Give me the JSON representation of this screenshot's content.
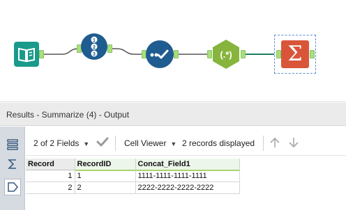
{
  "workflow": {
    "tools": [
      {
        "name": "input-data-tool",
        "icon": "book-icon",
        "color": "#1a9a8a"
      },
      {
        "name": "record-id-tool",
        "icon": "numbered-list-icon",
        "color": "#1f5c8f"
      },
      {
        "name": "select-tool",
        "icon": "checkmark-icon",
        "color": "#1f5c8f"
      },
      {
        "name": "regex-tool",
        "icon": "regex-icon",
        "color": "#86b43d",
        "glyph": "(.*)"
      },
      {
        "name": "summarize-tool",
        "icon": "sigma-icon",
        "color": "#d9553a",
        "glyph": "Σ"
      }
    ]
  },
  "results": {
    "title": "Results - Summarize (4) - Output"
  },
  "toolbar": {
    "fields_label": "2 of 2 Fields",
    "cell_viewer_label": "Cell Viewer",
    "records_label": "2 records displayed"
  },
  "grid": {
    "columns": [
      "Record",
      "RecordID",
      "Concat_Field1"
    ],
    "rows": [
      {
        "record": "1",
        "record_id": "1",
        "concat": "1111-1111-1111-1111"
      },
      {
        "record": "2",
        "record_id": "2",
        "concat": "2222-2222-2222-2222"
      }
    ]
  }
}
